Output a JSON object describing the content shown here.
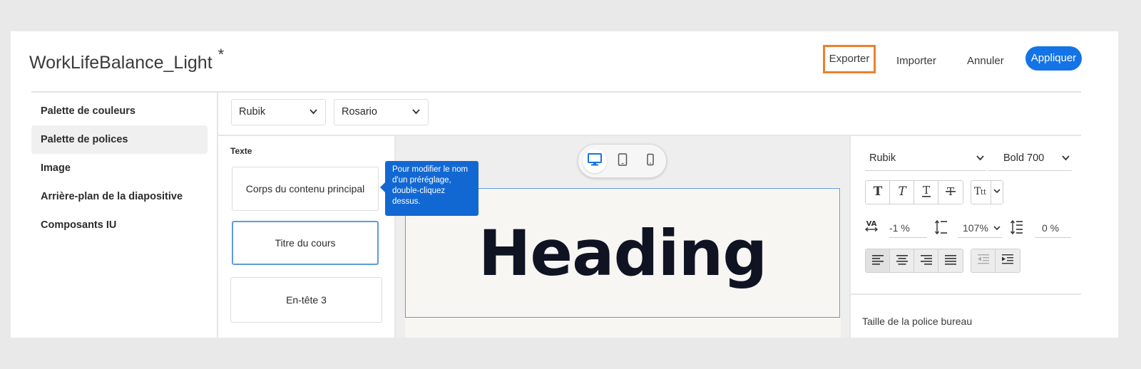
{
  "header": {
    "title": "WorkLifeBalance_Light",
    "unsaved_marker": "*",
    "export_label": "Exporter",
    "import_label": "Importer",
    "cancel_label": "Annuler",
    "apply_label": "Appliquer"
  },
  "sidebar": {
    "items": [
      {
        "label": "Palette de couleurs",
        "active": false
      },
      {
        "label": "Palette de polices",
        "active": true
      },
      {
        "label": "Image",
        "active": false
      },
      {
        "label": "Arrière-plan de la diapositive",
        "active": false
      },
      {
        "label": "Composants IU",
        "active": false
      }
    ]
  },
  "font_selects": {
    "primary": "Rubik",
    "secondary": "Rosario"
  },
  "presets": {
    "section_label": "Texte",
    "items": [
      {
        "label": "Corps du contenu principal"
      },
      {
        "label": "Titre du cours",
        "selected": true
      },
      {
        "label": "En-tête 3"
      }
    ],
    "tooltip": "Pour modifier le nom d'un préréglage, double-cliquez dessus."
  },
  "canvas": {
    "devices": [
      "desktop-icon",
      "tablet-icon",
      "mobile-icon"
    ],
    "active_device": "desktop",
    "preview_text": "Heading"
  },
  "properties": {
    "font_family": "Rubik",
    "font_weight": "Bold 700",
    "tracking": "-1 %",
    "line_height": "107%",
    "paragraph_spacing": "0 %",
    "desktop_size_label": "Taille de la police bureau"
  },
  "colors": {
    "accent": "#1473e6",
    "highlight": "#ee7f2d",
    "tooltip_bg": "#1268d3",
    "heading": "#0f1322"
  }
}
